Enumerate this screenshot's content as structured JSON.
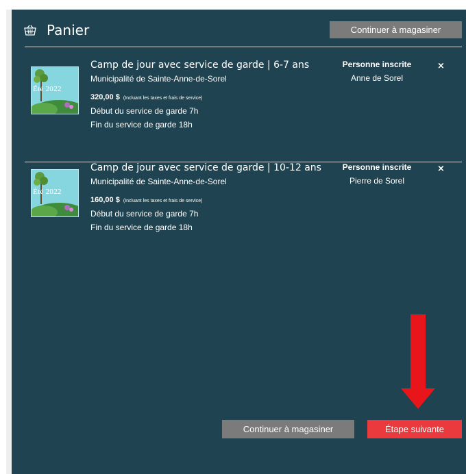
{
  "header": {
    "title": "Panier",
    "continue_label": "Continuer à magasiner",
    "icon": "basket-icon"
  },
  "items": [
    {
      "thumb_text": "Été 2022",
      "title": "Camp de jour avec service de garde | 6-7 ans",
      "municipality": "Municipalité de Sainte-Anne-de-Sorel",
      "price": "320,00 $",
      "price_note": "(Incluant les taxes et frais de service)",
      "line1": "Début du service de garde 7h",
      "line2": "Fin du service de garde 18h",
      "registered_label": "Personne inscrite",
      "registered_name": "Anne de Sorel",
      "remove": "×"
    },
    {
      "thumb_text": "Été 2022",
      "title": "Camp de jour avec service de garde | 10-12 ans",
      "municipality": "Municipalité de Sainte-Anne-de-Sorel",
      "price": "160,00 $",
      "price_note": "(Incluant les taxes et frais de service)",
      "line1": "Début du service de garde 7h",
      "line2": "Fin du service de garde 18h",
      "registered_label": "Personne inscrite",
      "registered_name": "Pierre de Sorel",
      "remove": "×"
    }
  ],
  "footer": {
    "continue_label": "Continuer à magasiner",
    "next_label": "Étape suivante"
  },
  "colors": {
    "panel": "#1f4350",
    "grey_button": "#7b7b7b",
    "next_button": "#ea3a3d",
    "arrow": "#e8151b"
  }
}
